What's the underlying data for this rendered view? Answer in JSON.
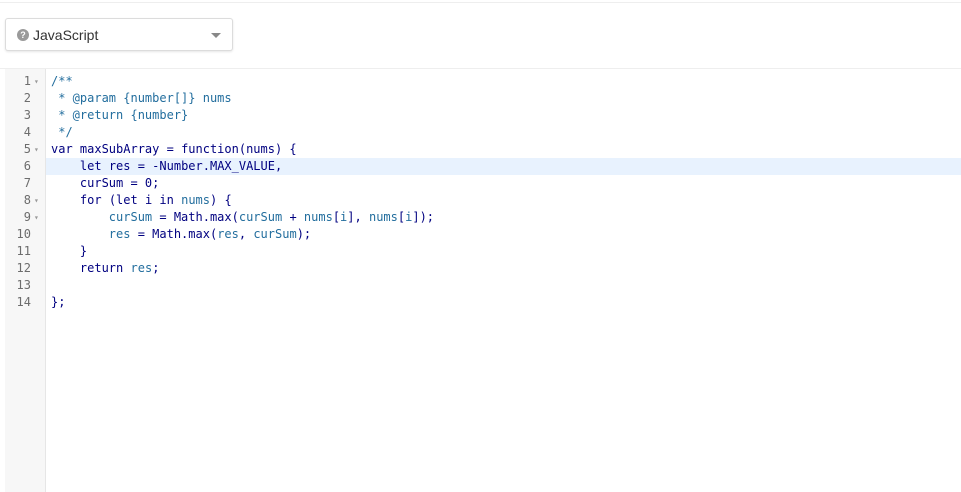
{
  "language_selector": {
    "selected": "JavaScript",
    "help_icon": "question-circle-icon",
    "caret_icon": "caret-down-icon"
  },
  "editor": {
    "active_line": 6,
    "folds": [
      1,
      5,
      8,
      9
    ],
    "lines": [
      [
        [
          "comment",
          "/**"
        ]
      ],
      [
        [
          "comment",
          " * @param {number[]} nums"
        ]
      ],
      [
        [
          "comment",
          " * @return {number}"
        ]
      ],
      [
        [
          "comment",
          " */"
        ]
      ],
      [
        [
          "kw",
          "var"
        ],
        [
          "plain",
          " maxSubArray = "
        ],
        [
          "kw",
          "function"
        ],
        [
          "plain",
          "(nums) {"
        ]
      ],
      [
        [
          "plain",
          "    "
        ],
        [
          "kw",
          "let"
        ],
        [
          "plain",
          " res = -Number.MAX_VALUE,"
        ]
      ],
      [
        [
          "plain",
          "    curSum = 0;"
        ]
      ],
      [
        [
          "plain",
          "    "
        ],
        [
          "kw",
          "for"
        ],
        [
          "plain",
          " ("
        ],
        [
          "kw",
          "let"
        ],
        [
          "plain",
          " i "
        ],
        [
          "kw",
          "in"
        ],
        [
          "plain",
          " "
        ],
        [
          "var",
          "nums"
        ],
        [
          "plain",
          ") {"
        ]
      ],
      [
        [
          "plain",
          "        "
        ],
        [
          "var",
          "curSum"
        ],
        [
          "plain",
          " = Math.max("
        ],
        [
          "var",
          "curSum"
        ],
        [
          "plain",
          " + "
        ],
        [
          "var",
          "nums"
        ],
        [
          "plain",
          "["
        ],
        [
          "var",
          "i"
        ],
        [
          "plain",
          "], "
        ],
        [
          "var",
          "nums"
        ],
        [
          "plain",
          "["
        ],
        [
          "var",
          "i"
        ],
        [
          "plain",
          "]);"
        ]
      ],
      [
        [
          "plain",
          "        "
        ],
        [
          "var",
          "res"
        ],
        [
          "plain",
          " = Math.max("
        ],
        [
          "var",
          "res"
        ],
        [
          "plain",
          ", "
        ],
        [
          "var",
          "curSum"
        ],
        [
          "plain",
          ");"
        ]
      ],
      [
        [
          "plain",
          "    }"
        ]
      ],
      [
        [
          "plain",
          "    "
        ],
        [
          "kw",
          "return"
        ],
        [
          "plain",
          " "
        ],
        [
          "var",
          "res"
        ],
        [
          "plain",
          ";"
        ]
      ],
      [],
      [
        [
          "plain",
          "};"
        ]
      ]
    ]
  }
}
